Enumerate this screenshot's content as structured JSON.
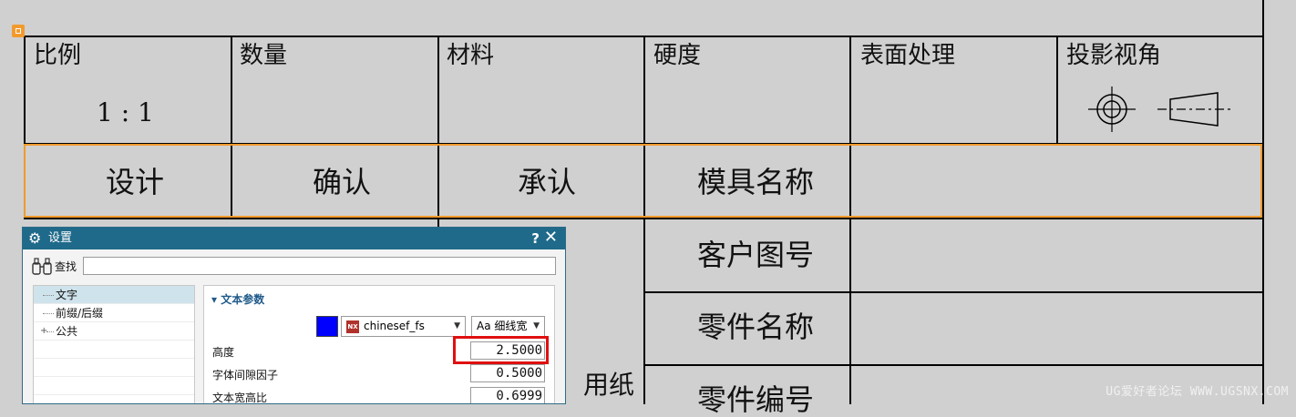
{
  "title_block": {
    "header_labels": [
      "比例",
      "数量",
      "材料",
      "硬度",
      "表面处理",
      "投影视角"
    ],
    "scale_value": "1 : 1",
    "approval_labels": [
      "设计",
      "确认",
      "承认",
      "模具名称"
    ],
    "right_labels": [
      "客户图号",
      "零件名称",
      "零件编号"
    ],
    "paper_label": "用纸"
  },
  "dialog": {
    "title": "设置",
    "help": "?",
    "close": "✕",
    "find_label": "查找",
    "find_value": "",
    "tree": [
      {
        "label": "文字",
        "selected": true,
        "expandable": false
      },
      {
        "label": "前缀/后缀",
        "selected": false,
        "expandable": false
      },
      {
        "label": "公共",
        "selected": false,
        "expandable": true
      }
    ],
    "section_title": "文本参数",
    "text_color": "#0000ff",
    "font_badge": "NX",
    "font_name": "chinesef_fs",
    "font_style": "Aa 细线宽",
    "params": [
      {
        "label": "高度",
        "value": "2.5000"
      },
      {
        "label": "字体间隙因子",
        "value": "0.5000"
      },
      {
        "label": "文本宽高比",
        "value": "0.6999"
      }
    ]
  },
  "watermark": "UG爱好者论坛 WWW.UGSNX.COM",
  "colors": {
    "selection": "#f29a2e",
    "highlight": "#e01010",
    "dialog_title_bg": "#1f6a8a",
    "canvas_bg": "#d0d0d0"
  }
}
